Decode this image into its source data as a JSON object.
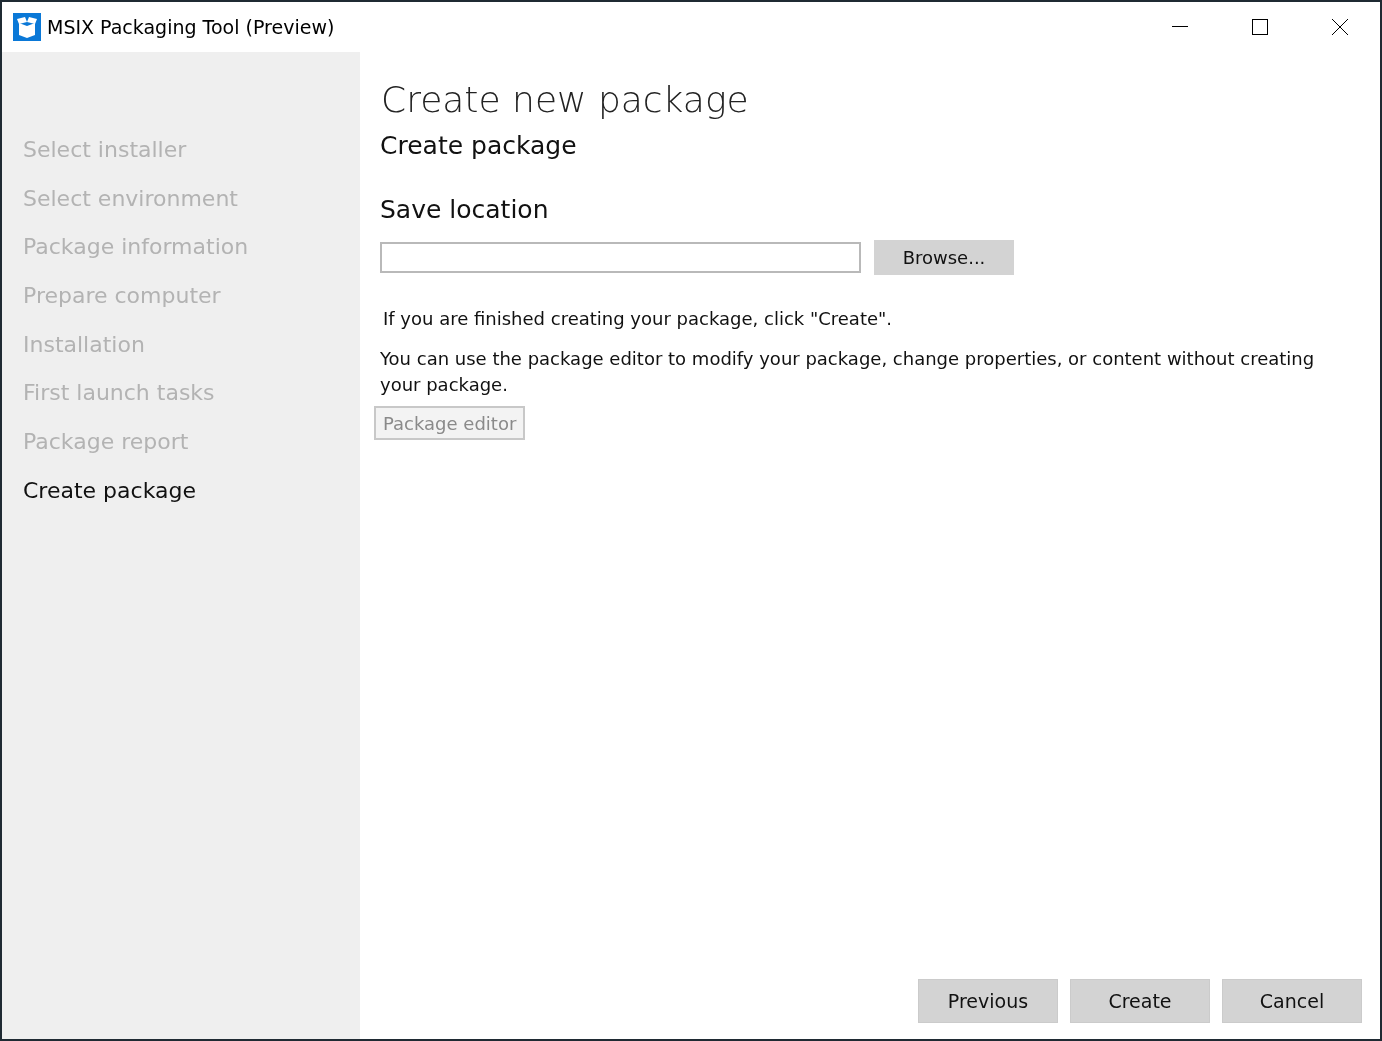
{
  "window": {
    "title": "MSIX Packaging Tool (Preview)"
  },
  "steps": [
    {
      "label": "Select installer",
      "selected": false
    },
    {
      "label": "Select environment",
      "selected": false
    },
    {
      "label": "Package information",
      "selected": false
    },
    {
      "label": "Prepare computer",
      "selected": false
    },
    {
      "label": "Installation",
      "selected": false
    },
    {
      "label": "First launch tasks",
      "selected": false
    },
    {
      "label": "Package report",
      "selected": false
    },
    {
      "label": "Create package",
      "selected": true
    }
  ],
  "page_title": "Create new package",
  "section_title": "Create package",
  "save_location": {
    "label": "Save location",
    "browse": "Browse..."
  },
  "info_text": "If you are finished creating your package, click \"Create\".",
  "editor_text": "You can use the package editor to modify your package, change properties, or content without creating your package.",
  "package_editor": {
    "label": "Package editor",
    "disabled": true
  },
  "buttons": [
    "Previous",
    "Create",
    "Cancel"
  ]
}
